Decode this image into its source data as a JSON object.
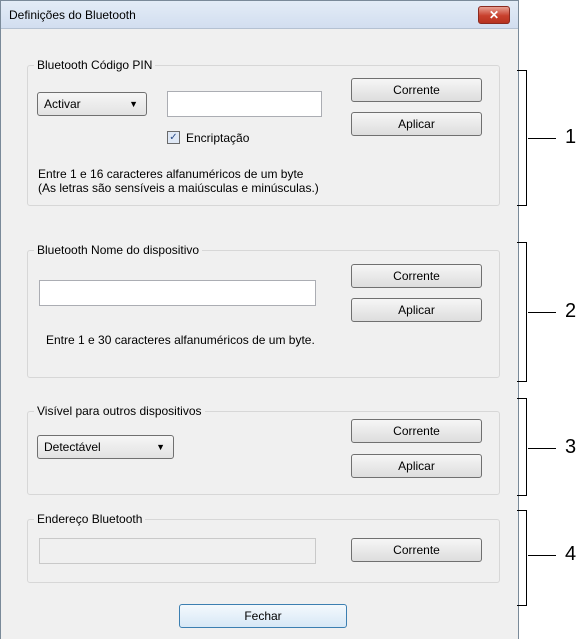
{
  "window": {
    "title": "Definições do Bluetooth",
    "close_label": "✕"
  },
  "pin": {
    "legend": "Bluetooth Código PIN",
    "combo_value": "Activar",
    "input_value": "",
    "encryption_label": "Encriptação",
    "encryption_checked": true,
    "help_line1": "Entre 1 e 16 caracteres alfanuméricos de um byte",
    "help_line2": "(As letras são sensíveis a maiúsculas e minúsculas.)",
    "current_label": "Corrente",
    "apply_label": "Aplicar"
  },
  "name": {
    "legend": "Bluetooth Nome do dispositivo",
    "input_value": "",
    "help": "Entre 1 e 30 caracteres alfanuméricos de um byte.",
    "current_label": "Corrente",
    "apply_label": "Aplicar"
  },
  "visibility": {
    "legend": "Visível para outros dispositivos",
    "combo_value": "Detectável",
    "current_label": "Corrente",
    "apply_label": "Aplicar"
  },
  "address": {
    "legend": "Endereço Bluetooth",
    "value": "",
    "current_label": "Corrente"
  },
  "footer": {
    "close_button": "Fechar"
  },
  "callouts": [
    "1",
    "2",
    "3",
    "4"
  ]
}
